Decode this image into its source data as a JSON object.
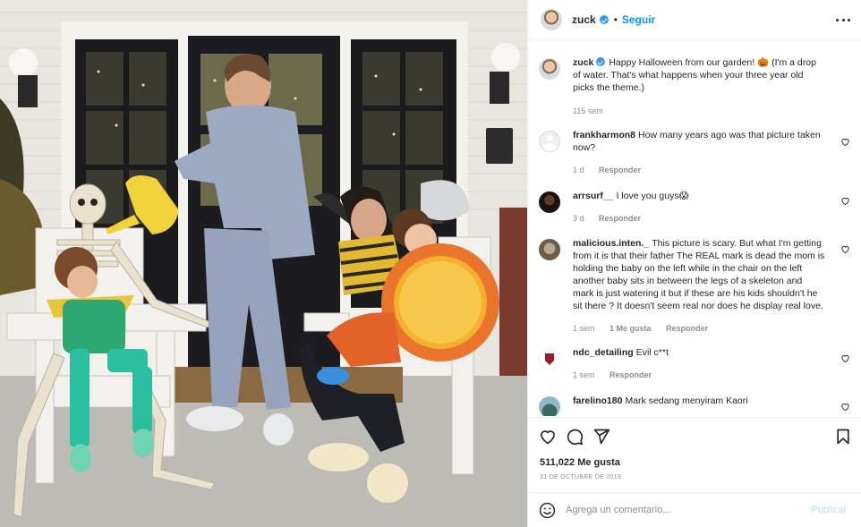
{
  "post": {
    "username": "zuck",
    "follow_label": "Seguir",
    "separator": "•"
  },
  "caption": {
    "username": "zuck",
    "text": "Happy Halloween from our garden! 🎃 (I'm a drop of water. That's what happens when your three year old picks the theme.)",
    "age": "115 sem"
  },
  "comments": [
    {
      "username": "frankharmon8",
      "text": "How many years ago was that picture taken now?",
      "age": "1 d",
      "likes": "",
      "reply": "Responder"
    },
    {
      "username": "arrsurf__",
      "text": "I love you guys😱",
      "age": "3 d",
      "likes": "",
      "reply": "Responder"
    },
    {
      "username": "malicious.inten._",
      "text": "This picture is scary. But what I'm getting from it is that their father The REAL mark is dead the mom is holding the baby on the left while in the chair on the left another baby sits in between the legs of a skeleton and mark is just watering it but if these are his kids shouldn't he sit there ? It doesn't seem real nor does he display real love.",
      "age": "1 sem",
      "likes": "1 Me gusta",
      "reply": "Responder"
    },
    {
      "username": "ndc_detailing",
      "text": "Evil c**t",
      "age": "1 sem",
      "likes": "",
      "reply": "Responder"
    },
    {
      "username": "farelino180",
      "text": "Mark sedang menyiram Kaori",
      "age": "",
      "likes": "",
      "reply": ""
    }
  ],
  "stats": {
    "likes": "511,022 Me gusta",
    "date": "31 DE OCTUBRE DE 2019"
  },
  "composer": {
    "placeholder": "Agrega un comentario...",
    "publish_label": "Publicar"
  },
  "icons": {
    "like": "heart-icon",
    "comment": "comment-icon",
    "share": "paper-plane-icon",
    "save": "bookmark-icon",
    "more": "more-options-icon",
    "emoji": "emoji-icon",
    "verified": "verified-badge-icon"
  },
  "colors": {
    "link": "#0095f6",
    "verified": "#3897f0",
    "muted": "#8e8e8e",
    "publish_disabled": "#b2dffc"
  }
}
